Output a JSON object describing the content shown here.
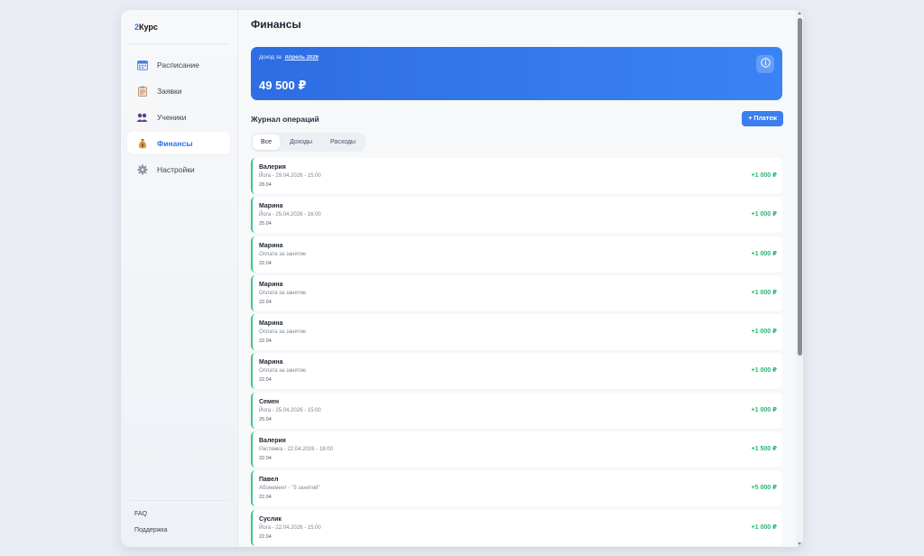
{
  "app": {
    "logo_prefix": "2",
    "logo_suffix": "Курс"
  },
  "sidebar": {
    "items": [
      {
        "label": "Расписание",
        "icon": "calendar-icon",
        "active": false
      },
      {
        "label": "Заявки",
        "icon": "clipboard-icon",
        "active": false
      },
      {
        "label": "Ученики",
        "icon": "students-icon",
        "active": false
      },
      {
        "label": "Финансы",
        "icon": "money-bag-icon",
        "active": true
      },
      {
        "label": "Настройки",
        "icon": "gear-icon",
        "active": false
      }
    ],
    "faq": "FAQ",
    "support": "Поддержка"
  },
  "page": {
    "title": "Финансы"
  },
  "income": {
    "label": "Доход за",
    "month": "Апрель 2026",
    "value": "49 500 ₽"
  },
  "journal": {
    "title": "Журнал операций",
    "add_button": "+ Платеж",
    "tabs": [
      "Все",
      "Доходы",
      "Расходы"
    ],
    "active_tab": "Все",
    "operations": [
      {
        "name": "Валерия",
        "desc": "Йога - 29.04.2026 - 15:00",
        "date": "28.04",
        "amount": "+1 000 ₽"
      },
      {
        "name": "Марина",
        "desc": "Йога - 25.04.2026 - 16:00",
        "date": "25.04",
        "amount": "+1 000 ₽"
      },
      {
        "name": "Марина",
        "desc": "Оплата за занятие",
        "date": "22.04",
        "amount": "+1 000 ₽"
      },
      {
        "name": "Марина",
        "desc": "Оплата за занятие",
        "date": "22.04",
        "amount": "+1 000 ₽"
      },
      {
        "name": "Марина",
        "desc": "Оплата за занятие",
        "date": "22.04",
        "amount": "+1 000 ₽"
      },
      {
        "name": "Марина",
        "desc": "Оплата за занятие",
        "date": "22.04",
        "amount": "+1 000 ₽"
      },
      {
        "name": "Семен",
        "desc": "Йога - 25.04.2026 - 15:00",
        "date": "25.04",
        "amount": "+1 000 ₽"
      },
      {
        "name": "Валерия",
        "desc": "Растяжка - 22.04.2026 - 16:00",
        "date": "22.04",
        "amount": "+1 500 ₽"
      },
      {
        "name": "Павел",
        "desc": "Абонемент - \"5 занятий\"",
        "date": "22.04",
        "amount": "+5 000 ₽"
      },
      {
        "name": "Суслик",
        "desc": "Йога - 22.04.2026 - 15:00",
        "date": "22.04",
        "amount": "+1 000 ₽"
      }
    ]
  },
  "fab": {
    "label": "+"
  },
  "colors": {
    "accent": "#3b7ff0",
    "positive": "#2bb673"
  }
}
